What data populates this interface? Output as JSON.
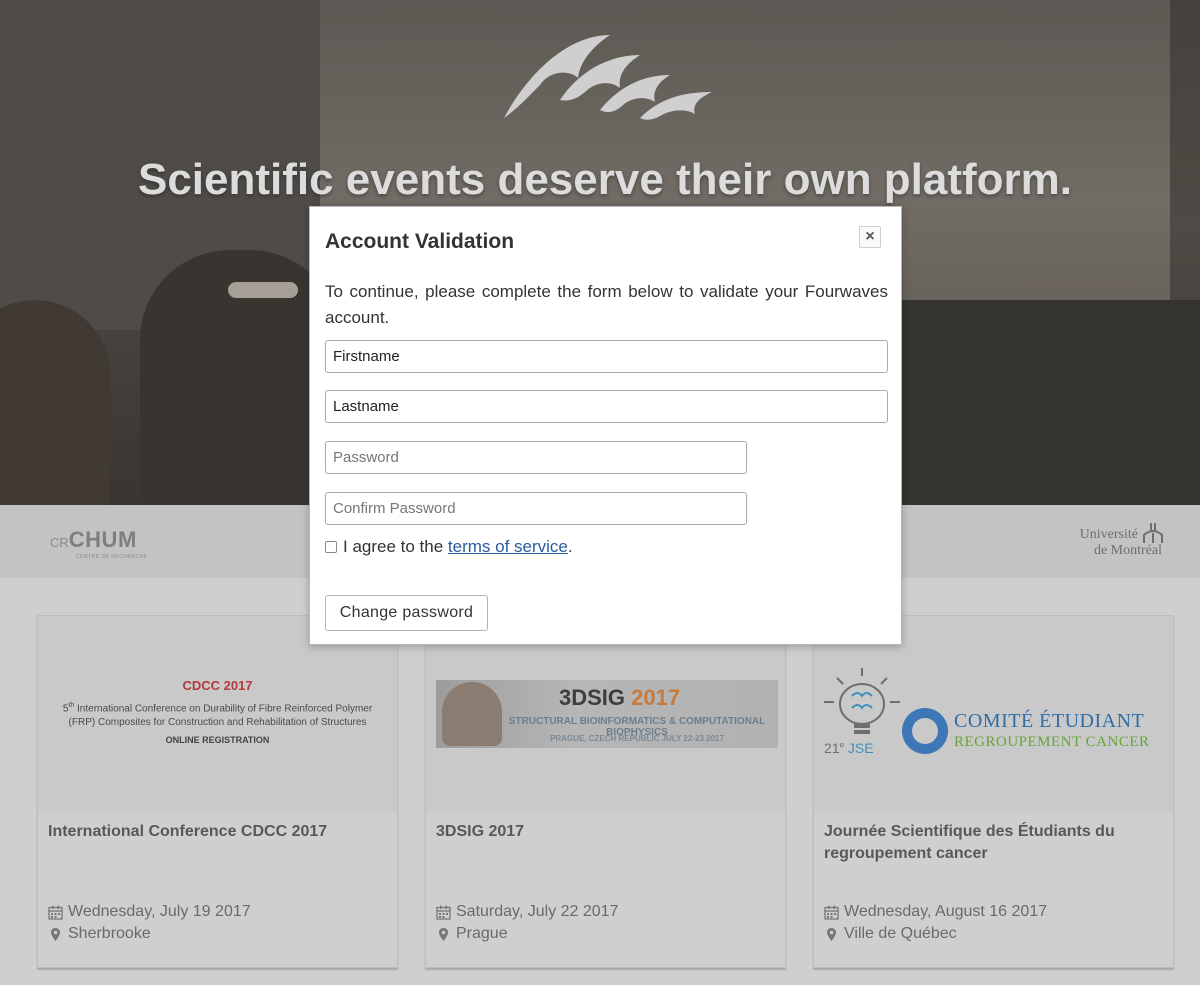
{
  "hero": {
    "title": "Scientific events deserve their own platform.",
    "logo_icon": "fourwaves-logo"
  },
  "partners": {
    "left": {
      "cr": "CR",
      "chum": "CHUM",
      "sub": "CENTRE DE RECHERCHE"
    },
    "right": {
      "line1": "Université",
      "line2": "de Montréal"
    }
  },
  "cards": [
    {
      "image": {
        "heading": "CDCC 2017",
        "line_sup": "th",
        "line1_prefix": "5",
        "line1_rest": " International Conference on Durability of Fibre Reinforced Polymer",
        "line2": "(FRP) Composites for Construction and Rehabilitation of Structures",
        "line3": "ONLINE REGISTRATION"
      },
      "title": "International Conference CDCC 2017",
      "date": "Wednesday, July 19 2017",
      "location": "Sherbrooke"
    },
    {
      "image": {
        "t1a": "3DSIG ",
        "t1b": "2017",
        "t2": "STRUCTURAL BIOINFORMATICS & COMPUTATIONAL BIOPHYSICS",
        "t3": "PRAGUE, CZECH REPUBLIC JULY 22-23 2017"
      },
      "title": "3DSIG 2017",
      "date": "Saturday, July 22 2017",
      "location": "Prague"
    },
    {
      "image": {
        "jse_num": "21",
        "jse_sup": "e",
        "jse_text": "JSE",
        "comite1": "COMITÉ ÉTUDIANT",
        "comite2": "REGROUPEMENT CANCER"
      },
      "title": "Journée Scientifique des Étudiants du regroupement cancer",
      "date": "Wednesday, August 16 2017",
      "location": "Ville de Québec"
    }
  ],
  "modal": {
    "title": "Account Validation",
    "close_icon": "close-icon",
    "intro": "To continue, please complete the form below to validate your Fourwaves account.",
    "firstname_value": "Firstname",
    "lastname_value": "Lastname",
    "password_placeholder": "Password",
    "confirm_placeholder": "Confirm Password",
    "agree_prefix": "I agree to the ",
    "agree_link": "terms of service",
    "agree_suffix": ".",
    "button": "Change password"
  },
  "icons": {
    "date": "calendar-icon",
    "location": "map-marker-icon"
  },
  "colors": {
    "link": "#2a5c9e",
    "cdcc_red": "#b33b3b",
    "dsig_orange": "#c97a3a",
    "comite_blue": "#2f6ea8",
    "comite_green": "#69a33a"
  }
}
